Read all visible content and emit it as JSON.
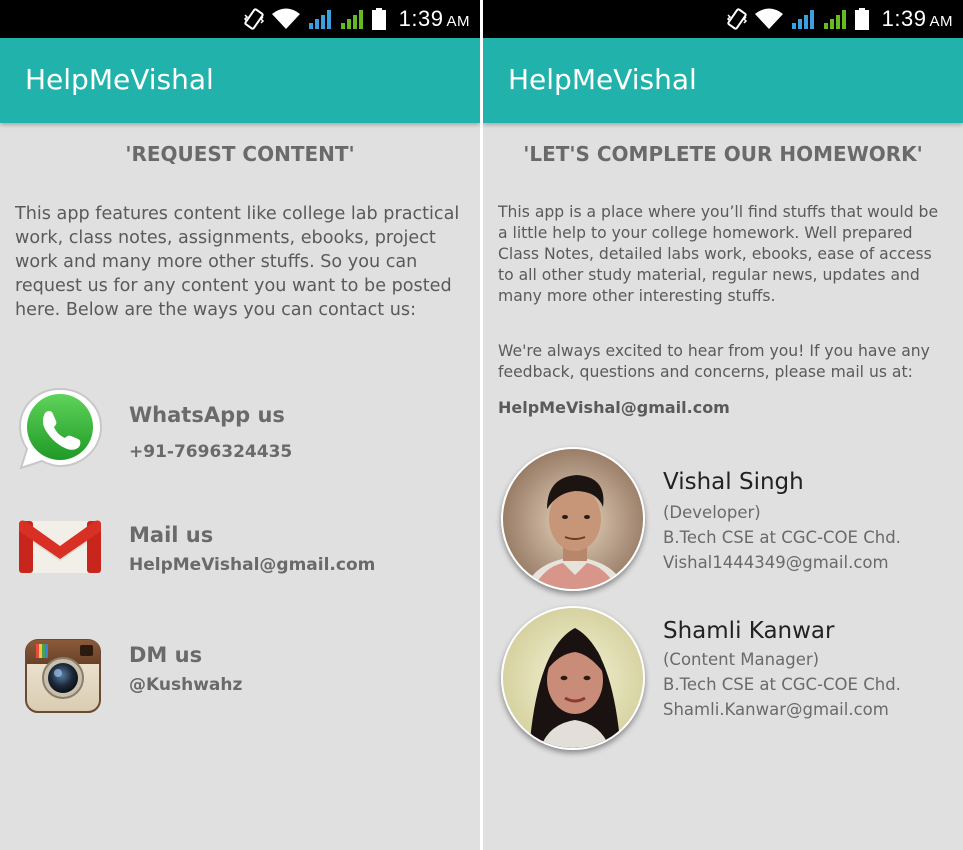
{
  "status_bar": {
    "time": "1:39",
    "ampm": "AM",
    "icons": [
      "vibrate-icon",
      "wifi-icon",
      "signal-icon-blue",
      "signal-icon-green",
      "battery-icon"
    ]
  },
  "left_screen": {
    "app_title": "HelpMeVishal",
    "heading": "'REQUEST CONTENT'",
    "intro": "This app features content like college lab practical work, class notes, assignments, ebooks, project work and many more other stuffs. So you can request us for any content you want to be posted here. Below are the ways you can contact us:",
    "contacts": [
      {
        "icon": "whatsapp-icon",
        "label": "WhatsApp us",
        "value": "+91-7696324435"
      },
      {
        "icon": "gmail-icon",
        "label": "Mail us",
        "value": "HelpMeVishal@gmail.com"
      },
      {
        "icon": "instagram-icon",
        "label": "DM us",
        "value": "@Kushwahz"
      }
    ]
  },
  "right_screen": {
    "app_title": "HelpMeVishal",
    "heading": "'LET'S COMPLETE OUR HOMEWORK'",
    "intro": "This app is a place where you’ll find stuffs that would be a little help to your college homework. Well prepared Class Notes, detailed labs work, ebooks, ease of access to all other study material, regular news, updates and many more other interesting stuffs.",
    "excited": "We're always excited to hear from you! If you have any feedback, questions and concerns, please mail us at:",
    "email": "HelpMeVishal@gmail.com",
    "people": [
      {
        "name": "Vishal Singh",
        "role": "(Developer)",
        "education": "B.Tech CSE at CGC-COE Chd.",
        "email": "Vishal1444349@gmail.com"
      },
      {
        "name": "Shamli Kanwar",
        "role": "(Content Manager)",
        "education": "B.Tech CSE at CGC-COE Chd.",
        "email": "Shamli.Kanwar@gmail.com"
      }
    ]
  },
  "colors": {
    "appbar": "#21b3ab",
    "background": "#e0e0e0",
    "text": "#5a5a5a",
    "whatsapp": "#3cb73e",
    "gmail_red": "#d93025"
  }
}
